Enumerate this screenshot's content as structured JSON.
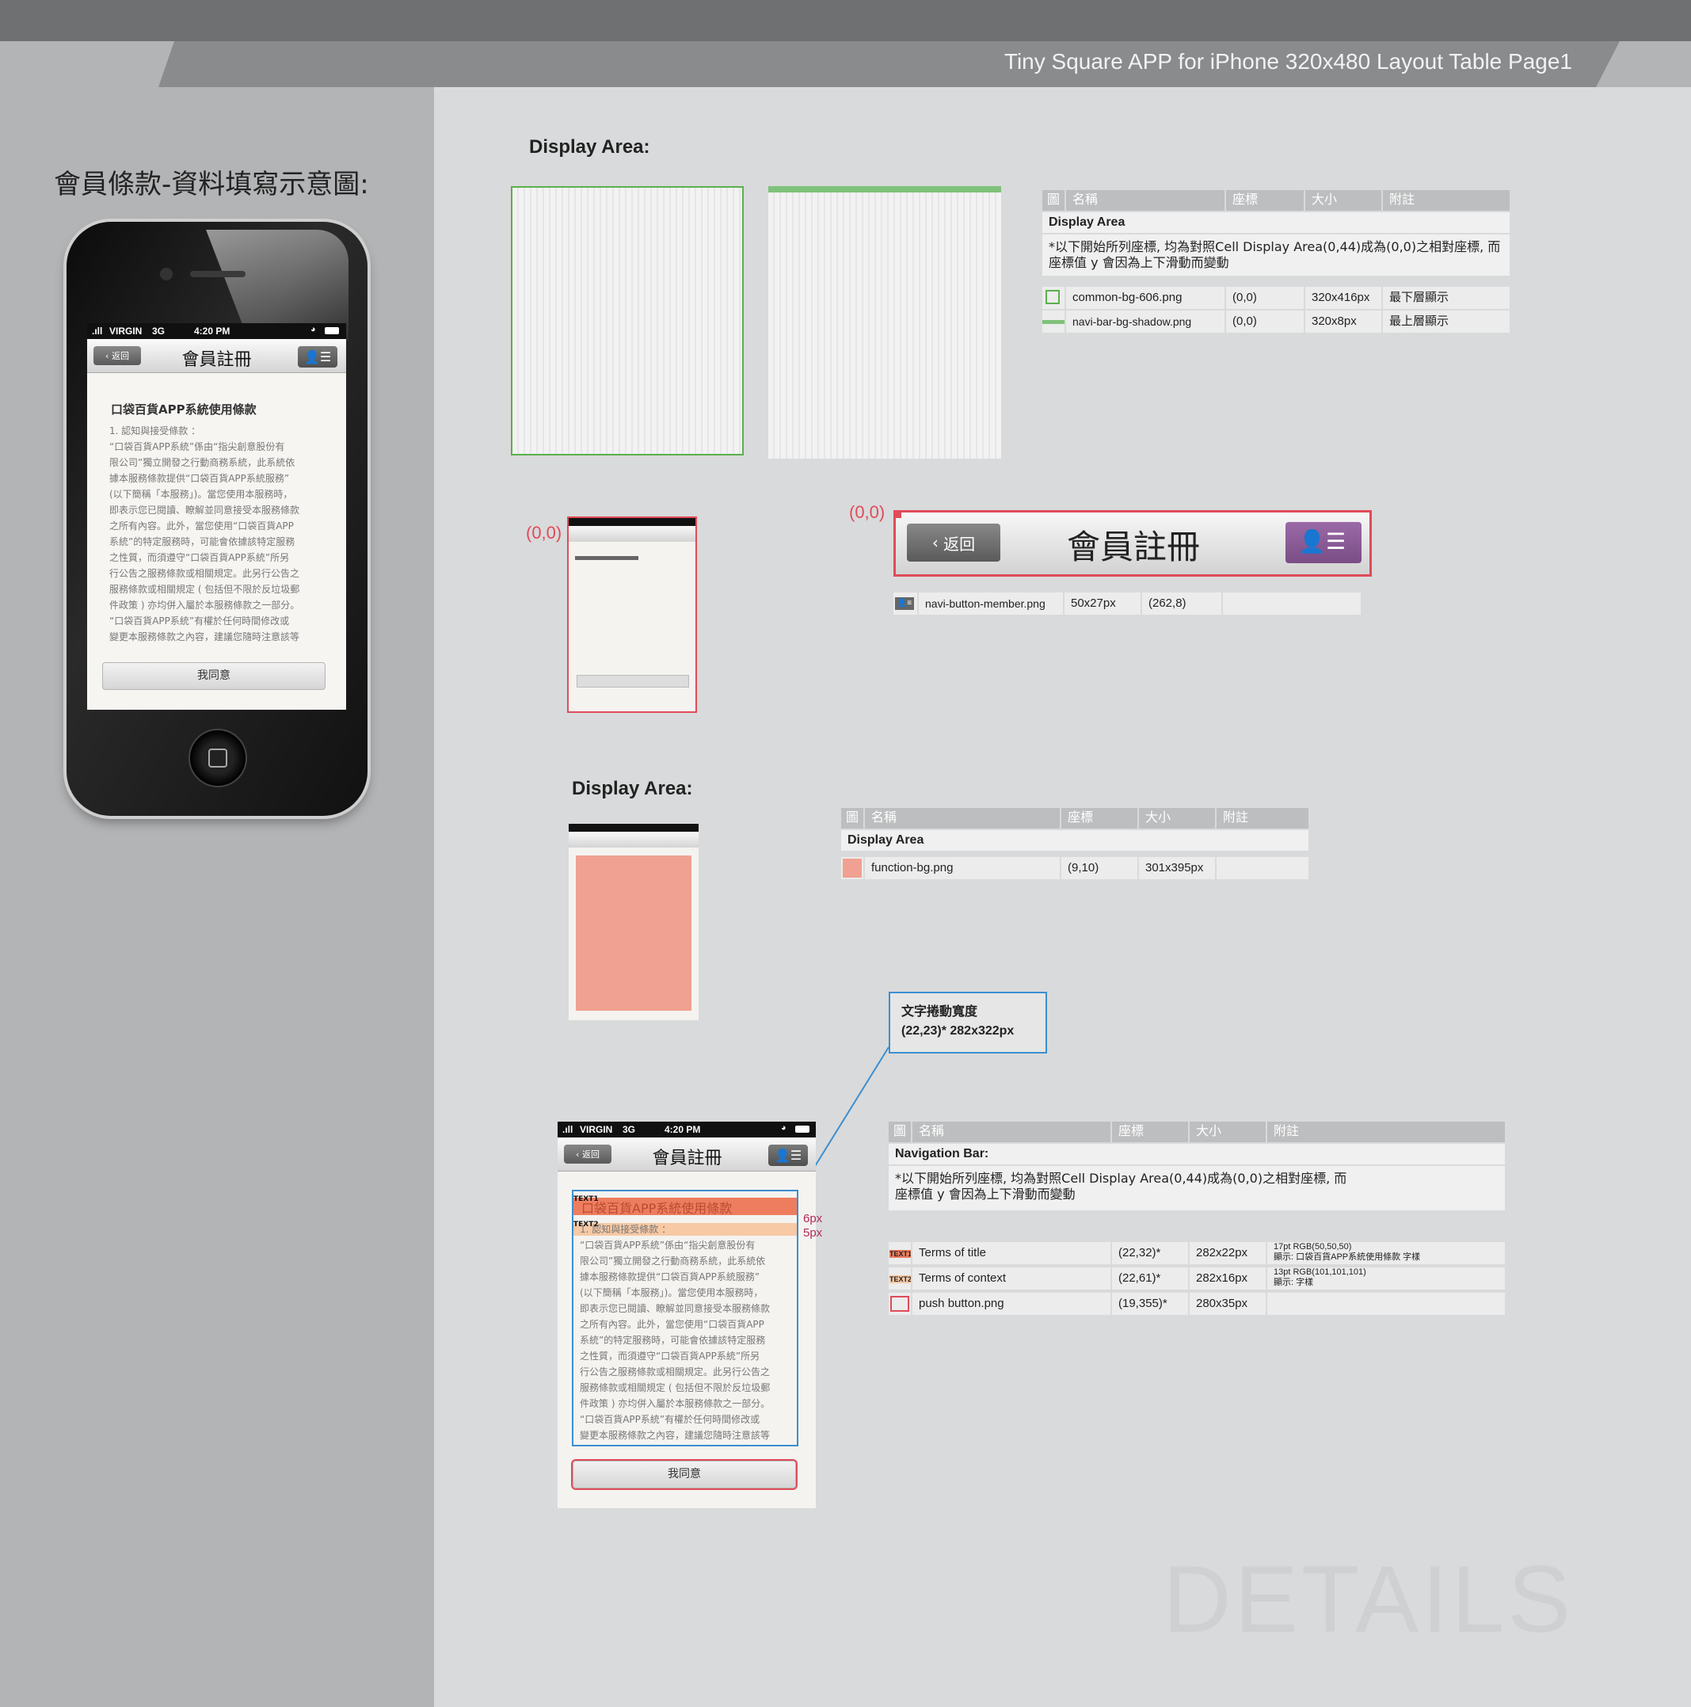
{
  "header": {
    "title": "Tiny Square APP for iPhone 320x480 Layout Table Page1"
  },
  "left": {
    "title": "會員條款-資料填寫示意圖:"
  },
  "phone": {
    "status": {
      "carrier": "VIRGIN",
      "network": "3G",
      "time": "4:20 PM"
    },
    "nav": {
      "back_label": "返回",
      "title": "會員註冊"
    },
    "content": {
      "title": "口袋百貨APP系統使用條款",
      "text": "1. 認知與接受條款 ：\n“口袋百貨APP系統”係由“指尖創意股份有\n限公司”獨立開發之行動商務系統，此系統依\n據本服務條款提供“口袋百貨APP系統服務”\n(以下簡稱「本服務」)。當您使用本服務時，\n即表示您已閱讀、瞭解並同意接受本服務條款\n之所有內容。此外，當您使用“口袋百貨APP\n系統”的特定服務時，可能會依據該特定服務\n之性質，而須遵守“口袋百貨APP系統”所另\n行公告之服務條款或相關規定。此另行公告之\n服務條款或相關規定 ( 包括但不限於反垃圾郵\n件政策 ) 亦均併入屬於本服務條款之一部分。\n“口袋百貨APP系統”有權於任何時間修改或\n變更本服務條款之內容，建議您隨時注意該等",
      "agree_label": "我同意"
    }
  },
  "section1": {
    "heading": "Display Area:",
    "origin_label": "(0,0)",
    "table": {
      "headers": [
        "圖",
        "名稱",
        "座標",
        "大小",
        "附註"
      ],
      "band": "Display Area",
      "note": "*以下開始所列座標, 均為對照Cell Display Area(0,44)成為(0,0)之相對座標, 而\n座標值 y 會因為上下滑動而變動",
      "rows": [
        {
          "name": "common-bg-606.png",
          "coord": "(0,0)",
          "size": "320x416px",
          "remark": "最下層顯示"
        },
        {
          "name": "navi-bar-bg-shadow.png",
          "coord": "(0,0)",
          "size": "320x8px",
          "remark": "最上層顯示"
        }
      ]
    },
    "navbar_sample": {
      "origin_label": "(0,0)",
      "back_label": "返回",
      "title": "會員註冊"
    },
    "button_row": {
      "name": "navi-button-member.png",
      "size": "50x27px",
      "coord": "(262,8)"
    }
  },
  "section2": {
    "heading": "Display Area:",
    "table": {
      "headers": [
        "圖",
        "名稱",
        "座標",
        "大小",
        "附註"
      ],
      "band": "Display Area",
      "rows": [
        {
          "name": "function-bg.png",
          "coord": "(9,10)",
          "size": "301x395px",
          "remark": ""
        }
      ]
    }
  },
  "section3": {
    "callout": {
      "line1": "文字捲動寬度",
      "line2": "(22,23)*  282x322px"
    },
    "labels": {
      "text1": "TEXT1",
      "text2": "TEXT2",
      "gap1": "6px",
      "gap2": "5px"
    },
    "table": {
      "headers": [
        "圖",
        "名稱",
        "座標",
        "大小",
        "附註"
      ],
      "band": "Navigation Bar:",
      "note": "*以下開始所列座標, 均為對照Cell Display Area(0,44)成為(0,0)之相對座標, 而\n座標值 y 會因為上下滑動而變動",
      "rows": [
        {
          "icon": "TEXT1",
          "name": "Terms of title",
          "coord": "(22,32)*",
          "size": "282x22px",
          "remark1": "17pt RGB(50,50,50)",
          "remark2": "顯示: 口袋百貨APP系統使用條款   字樣"
        },
        {
          "icon": "TEXT2",
          "name": "Terms of context",
          "coord": "(22,61)*",
          "size": "282x16px",
          "remark1": "13pt RGB(101,101,101)",
          "remark2": "顯示:   字樣"
        },
        {
          "icon": "",
          "name": "push button.png",
          "coord": "(19,355)*",
          "size": "280x35px",
          "remark1": "",
          "remark2": ""
        }
      ]
    }
  },
  "watermark": "DETAILS",
  "colors": {
    "accent_red": "#e04b59",
    "callout_blue": "#3b8fd0",
    "member_purple": "#8c5c97",
    "function_bg": "#f0a191"
  }
}
